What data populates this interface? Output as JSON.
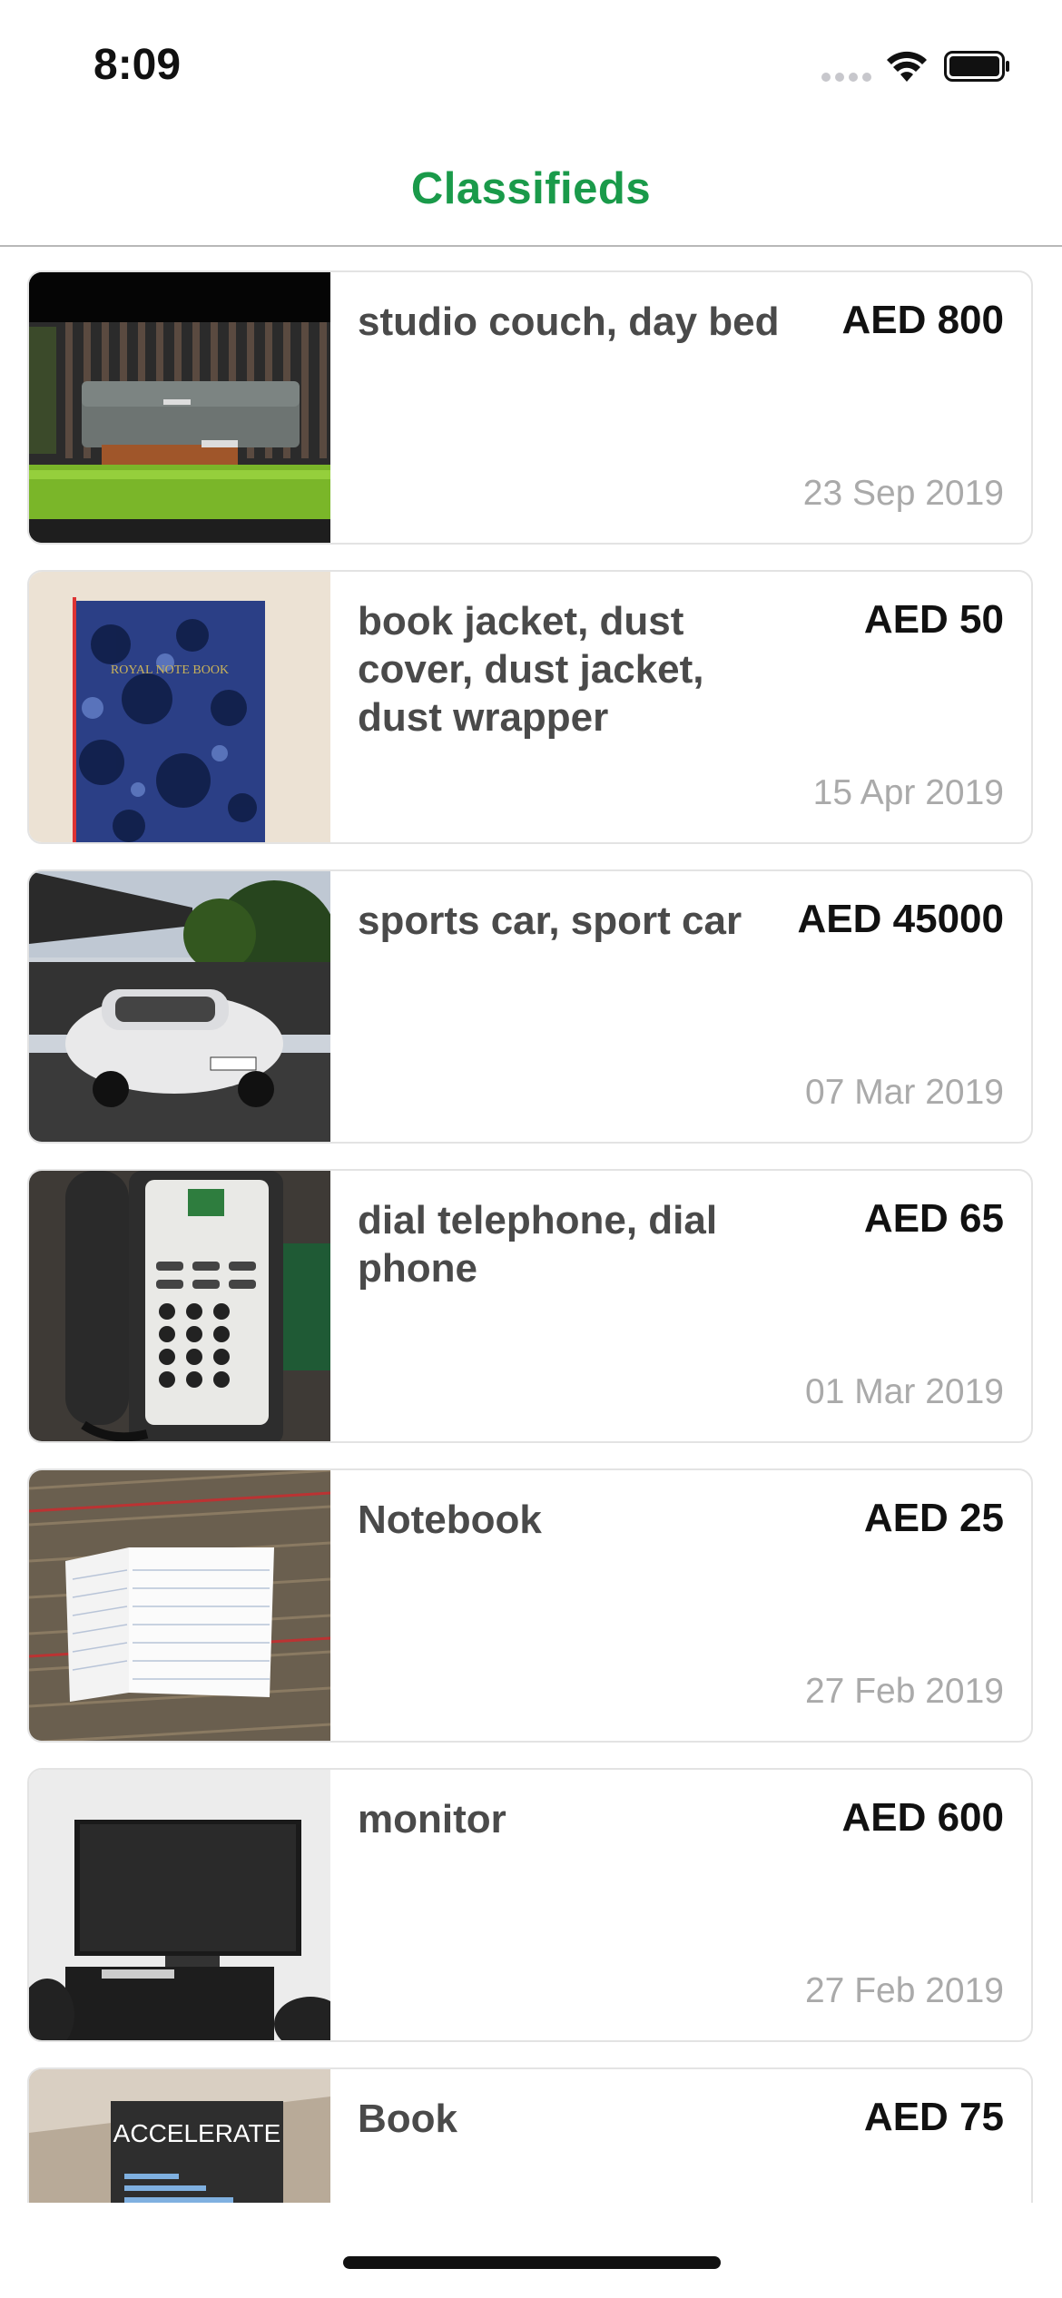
{
  "status_bar": {
    "time": "8:09"
  },
  "nav": {
    "title": "Classifieds"
  },
  "listings": [
    {
      "title": "studio couch, day bed",
      "price": "AED 800",
      "date": "23 Sep 2019",
      "image": "couch-photo"
    },
    {
      "title": "book jacket, dust cover, dust jacket, dust wrapper",
      "price": "AED 50",
      "date": "15 Apr 2019",
      "image": "notebook-photo"
    },
    {
      "title": "sports car, sport car",
      "price": "AED 45000",
      "date": "07 Mar 2019",
      "image": "car-photo"
    },
    {
      "title": "dial telephone, dial phone",
      "price": "AED 65",
      "date": "01 Mar 2019",
      "image": "telephone-photo"
    },
    {
      "title": "Notebook",
      "price": "AED 25",
      "date": "27 Feb 2019",
      "image": "open-notebook-photo"
    },
    {
      "title": "monitor",
      "price": "AED 600",
      "date": "27 Feb 2019",
      "image": "monitor-photo"
    },
    {
      "title": "Book",
      "price": "AED 75",
      "date": "",
      "image": "book-photo"
    }
  ],
  "thumb_text": {
    "notebook_cover": "ROYAL NOTE BOOK",
    "book_cover": "ACCELERATE",
    "book_subtitle": "Building and Scaling High Performing Technology Organizations"
  },
  "colors": {
    "accent": "#1a9a4a",
    "price": "#111111",
    "date": "#aaaaaa"
  }
}
